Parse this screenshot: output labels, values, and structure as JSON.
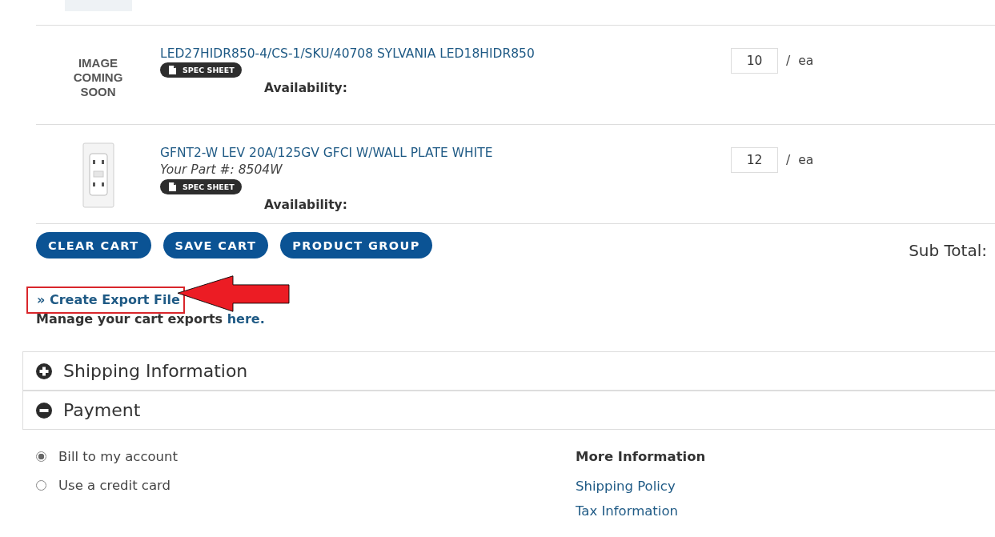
{
  "cart_items": [
    {
      "kind": "text",
      "image_text": "IMAGE COMING SOON",
      "name": "LED27HIDR850-4/CS-1/SKU/40708 SYLVANIA LED18HIDR850",
      "spec_sheet": "SPEC SHEET",
      "availability": "Availability:",
      "quantity": "10",
      "separator": "/",
      "unit": "ea"
    },
    {
      "kind": "outlet",
      "name": "GFNT2-W LEV 20A/125GV GFCI W/WALL PLATE WHITE",
      "part_number": "Your Part #: 8504W",
      "spec_sheet": "SPEC SHEET",
      "availability": "Availability:",
      "quantity": "12",
      "separator": "/",
      "unit": "ea"
    }
  ],
  "cart_buttons": [
    "CLEAR CART",
    "SAVE CART",
    "PRODUCT GROUP"
  ],
  "subtotal_label": "Sub Total:",
  "export": {
    "link": "» Create Export File",
    "highlighted": true,
    "manage_text": "Manage your cart exports",
    "manage_link": "here."
  },
  "sections": [
    {
      "title": "Shipping Information",
      "expanded": false
    },
    {
      "title": "Payment",
      "expanded": true
    }
  ],
  "payment_options": [
    {
      "label": "Bill to my account",
      "selected": true
    },
    {
      "label": "Use a credit card",
      "selected": false
    }
  ],
  "more_information": {
    "heading": "More Information",
    "links": [
      "Shipping Policy",
      "Tax Information"
    ]
  }
}
